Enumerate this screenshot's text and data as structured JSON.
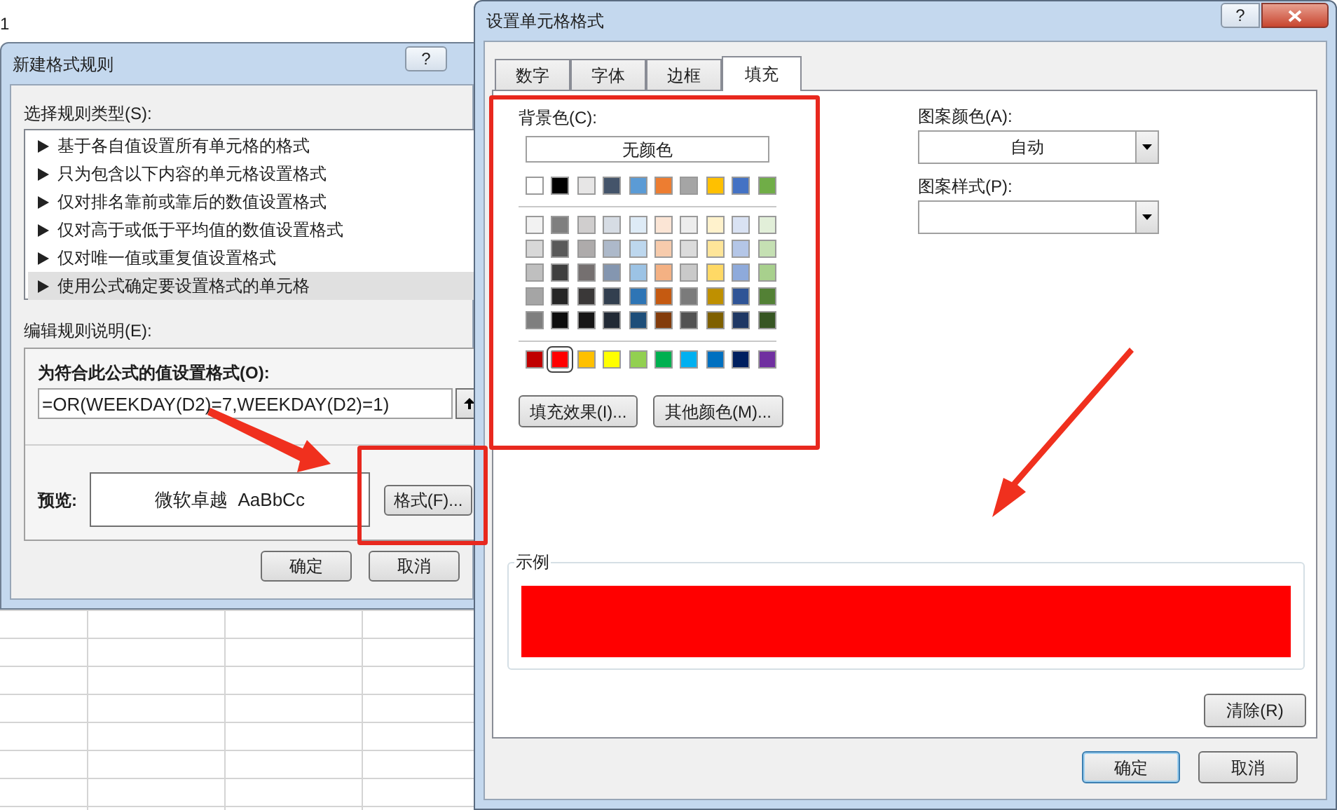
{
  "sheet": {
    "cell_text": "1"
  },
  "rule_dialog": {
    "title": "新建格式规则",
    "help_button": "?",
    "rule_type_label": "选择规则类型(S):",
    "rule_types": [
      {
        "label": "基于各自值设置所有单元格的格式",
        "selected": false
      },
      {
        "label": "只为包含以下内容的单元格设置格式",
        "selected": false
      },
      {
        "label": "仅对排名靠前或靠后的数值设置格式",
        "selected": false
      },
      {
        "label": "仅对高于或低于平均值的数值设置格式",
        "selected": false
      },
      {
        "label": "仅对唯一值或重复值设置格式",
        "selected": false
      },
      {
        "label": "使用公式确定要设置格式的单元格",
        "selected": true
      }
    ],
    "description_label": "编辑规则说明(E):",
    "formula_label": "为符合此公式的值设置格式(O):",
    "formula": "=OR(WEEKDAY(D2)=7,WEEKDAY(D2)=1)",
    "preview_label": "预览:",
    "preview_text": "微软卓越  AaBbCc",
    "format_button": "格式(F)...",
    "buttons": [
      "确定",
      "取消"
    ]
  },
  "format_dialog": {
    "title": "设置单元格格式",
    "help_button": "?",
    "tabs": [
      {
        "label": "数字",
        "selected": false
      },
      {
        "label": "字体",
        "selected": false
      },
      {
        "label": "边框",
        "selected": false
      },
      {
        "label": "填充",
        "selected": true
      }
    ],
    "background_color_label": "背景色(C):",
    "no_color_button": "无颜色",
    "theme_colors": [
      {
        "color": "#ffffff",
        "selected": false
      },
      {
        "color": "#000000",
        "selected": false
      },
      {
        "color": "#e7e6e6",
        "selected": false
      },
      {
        "color": "#44546a",
        "selected": false
      },
      {
        "color": "#5b9bd5",
        "selected": false
      },
      {
        "color": "#ed7d31",
        "selected": false
      },
      {
        "color": "#a5a5a5",
        "selected": false
      },
      {
        "color": "#ffc000",
        "selected": false
      },
      {
        "color": "#4472c4",
        "selected": false
      },
      {
        "color": "#70ad47",
        "selected": false
      }
    ],
    "tint_rows": [
      [
        {
          "color": "#f2f2f2",
          "selected": false
        },
        {
          "color": "#7f7f7f",
          "selected": false
        },
        {
          "color": "#d0cece",
          "selected": false
        },
        {
          "color": "#d6dce4",
          "selected": false
        },
        {
          "color": "#deebf6",
          "selected": false
        },
        {
          "color": "#fbe5d5",
          "selected": false
        },
        {
          "color": "#ededed",
          "selected": false
        },
        {
          "color": "#fff2cc",
          "selected": false
        },
        {
          "color": "#d9e2f3",
          "selected": false
        },
        {
          "color": "#e2efd9",
          "selected": false
        }
      ],
      [
        {
          "color": "#d8d8d8",
          "selected": false
        },
        {
          "color": "#595959",
          "selected": false
        },
        {
          "color": "#aeabab",
          "selected": false
        },
        {
          "color": "#adb9ca",
          "selected": false
        },
        {
          "color": "#bdd7ee",
          "selected": false
        },
        {
          "color": "#f7cbac",
          "selected": false
        },
        {
          "color": "#dbdbdb",
          "selected": false
        },
        {
          "color": "#fee599",
          "selected": false
        },
        {
          "color": "#b4c6e7",
          "selected": false
        },
        {
          "color": "#c5e0b3",
          "selected": false
        }
      ],
      [
        {
          "color": "#bfbfbf",
          "selected": false
        },
        {
          "color": "#3f3f3f",
          "selected": false
        },
        {
          "color": "#757070",
          "selected": false
        },
        {
          "color": "#8496b0",
          "selected": false
        },
        {
          "color": "#9cc3e5",
          "selected": false
        },
        {
          "color": "#f4b183",
          "selected": false
        },
        {
          "color": "#c9c9c9",
          "selected": false
        },
        {
          "color": "#ffd965",
          "selected": false
        },
        {
          "color": "#8eaadb",
          "selected": false
        },
        {
          "color": "#a8d08d",
          "selected": false
        }
      ],
      [
        {
          "color": "#a5a5a5",
          "selected": false
        },
        {
          "color": "#262626",
          "selected": false
        },
        {
          "color": "#3a3838",
          "selected": false
        },
        {
          "color": "#323f4f",
          "selected": false
        },
        {
          "color": "#2e75b5",
          "selected": false
        },
        {
          "color": "#c55a11",
          "selected": false
        },
        {
          "color": "#7b7b7b",
          "selected": false
        },
        {
          "color": "#bf9000",
          "selected": false
        },
        {
          "color": "#2f5496",
          "selected": false
        },
        {
          "color": "#538135",
          "selected": false
        }
      ],
      [
        {
          "color": "#7f7f7f",
          "selected": false
        },
        {
          "color": "#0c0c0c",
          "selected": false
        },
        {
          "color": "#171616",
          "selected": false
        },
        {
          "color": "#222a35",
          "selected": false
        },
        {
          "color": "#1e4e79",
          "selected": false
        },
        {
          "color": "#833c0b",
          "selected": false
        },
        {
          "color": "#525252",
          "selected": false
        },
        {
          "color": "#7f6000",
          "selected": false
        },
        {
          "color": "#1f3864",
          "selected": false
        },
        {
          "color": "#375623",
          "selected": false
        }
      ]
    ],
    "standard_colors": [
      {
        "color": "#c00000",
        "selected": false
      },
      {
        "color": "#ff0000",
        "selected": true
      },
      {
        "color": "#ffc000",
        "selected": false
      },
      {
        "color": "#ffff00",
        "selected": false
      },
      {
        "color": "#92d050",
        "selected": false
      },
      {
        "color": "#00b050",
        "selected": false
      },
      {
        "color": "#00b0f0",
        "selected": false
      },
      {
        "color": "#0070c0",
        "selected": false
      },
      {
        "color": "#002060",
        "selected": false
      },
      {
        "color": "#7030a0",
        "selected": false
      }
    ],
    "fill_effects_button": "填充效果(I)...",
    "more_colors_button": "其他颜色(M)...",
    "pattern_color_label": "图案颜色(A):",
    "pattern_color": "自动",
    "pattern_style_label": "图案样式(P):",
    "sample_label": "示例",
    "clear_button": "清除(R)",
    "buttons": [
      "确定",
      "取消"
    ]
  }
}
